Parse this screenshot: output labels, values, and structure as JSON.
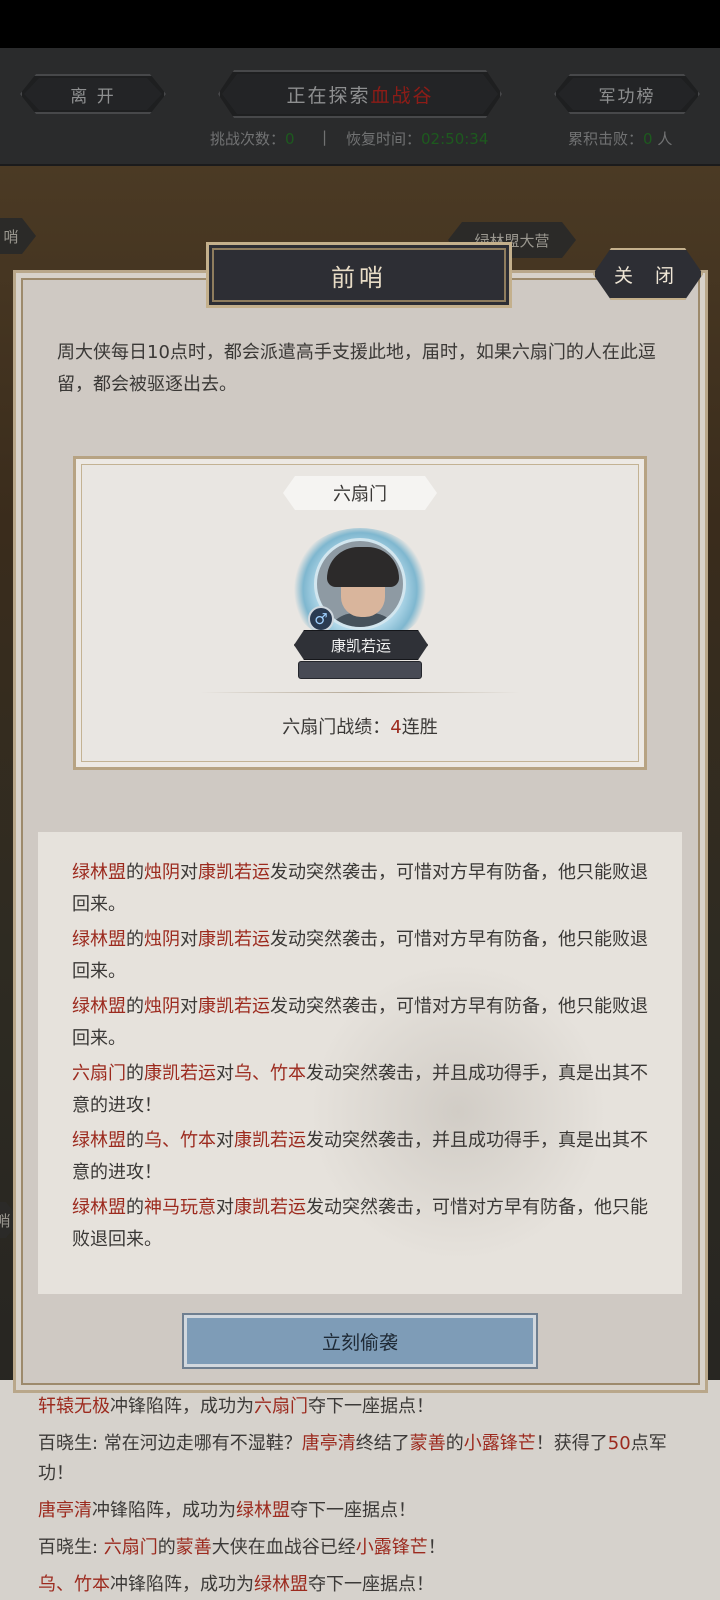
{
  "header": {
    "leave_label": "离 开",
    "explore_prefix": "正在探索",
    "explore_location": "血战谷",
    "rank_label": "军功榜",
    "challenge_label": "挑战次数：",
    "challenge_value": "0",
    "separator": "|",
    "recover_label": "恢复时间：",
    "recover_value": "02:50:34",
    "kills_label": "累积击败：",
    "kills_value": "0",
    "kills_unit": "人"
  },
  "map": {
    "camp_label": "绿林盟大营",
    "left_tag_1": "哨",
    "left_tag_2": "哨"
  },
  "dialog": {
    "title": "前哨",
    "close_label": "关 闭",
    "description": "周大侠每日10点时，都会派遣高手支援此地，届时，如果六扇门的人在此逗留，都会被驱逐出去。",
    "faction": "六扇门",
    "gender_symbol": "♂",
    "hero_name": "康凯若运",
    "record_label": "六扇门战绩：",
    "record_value": "4",
    "record_suffix": "连胜",
    "raid_button": "立刻偷袭"
  },
  "logs": [
    {
      "s1": "绿林盟",
      "t1": "的",
      "s2": "烛阴",
      "t2": "对",
      "s3": "康凯若运",
      "t3": "发动突然袭击，可惜对方早有防备，他只能败退回来。"
    },
    {
      "s1": "绿林盟",
      "t1": "的",
      "s2": "烛阴",
      "t2": "对",
      "s3": "康凯若运",
      "t3": "发动突然袭击，可惜对方早有防备，他只能败退回来。"
    },
    {
      "s1": "绿林盟",
      "t1": "的",
      "s2": "烛阴",
      "t2": "对",
      "s3": "康凯若运",
      "t3": "发动突然袭击，可惜对方早有防备，他只能败退回来。"
    },
    {
      "s1": "六扇门",
      "t1": "的",
      "s2": "康凯若运",
      "t2": "对",
      "s3": "乌、竹本",
      "t3": "发动突然袭击，并且成功得手，真是出其不意的进攻！"
    },
    {
      "s1": "绿林盟",
      "t1": "的",
      "s2": "乌、竹本",
      "t2": "对",
      "s3": "康凯若运",
      "t3": "发动突然袭击，并且成功得手，真是出其不意的进攻！"
    },
    {
      "s1": "绿林盟",
      "t1": "的",
      "s2": "神马玩意",
      "t2": "对",
      "s3": "康凯若运",
      "t3": "发动突然袭击，可惜对方早有防备，他只能败退回来。"
    }
  ],
  "bottom_log": {
    "line1": {
      "a": "轩辕无极",
      "b": "冲锋陷阵，成功为",
      "c": "六扇门",
      "d": "夺下一座据点！"
    },
    "line2": {
      "a": "百晓生: 常在河边走哪有不湿鞋？",
      "b": "唐亭清",
      "c": "终结了",
      "d": "蒙善",
      "e": "的",
      "f": "小露锋芒",
      "g": "！获得了",
      "h": "50",
      "i": "点军功！"
    },
    "line3": {
      "a": "唐亭清",
      "b": "冲锋陷阵，成功为",
      "c": "绿林盟",
      "d": "夺下一座据点！"
    },
    "line4": {
      "a": "百晓生: ",
      "b": "六扇门",
      "c": "的",
      "d": "蒙善",
      "e": "大侠在血战谷已经",
      "f": "小露锋芒",
      "g": "！"
    },
    "line5": {
      "a": "乌、竹本",
      "b": "冲锋陷阵，成功为",
      "c": "绿林盟",
      "d": "夺下一座据点！"
    }
  }
}
